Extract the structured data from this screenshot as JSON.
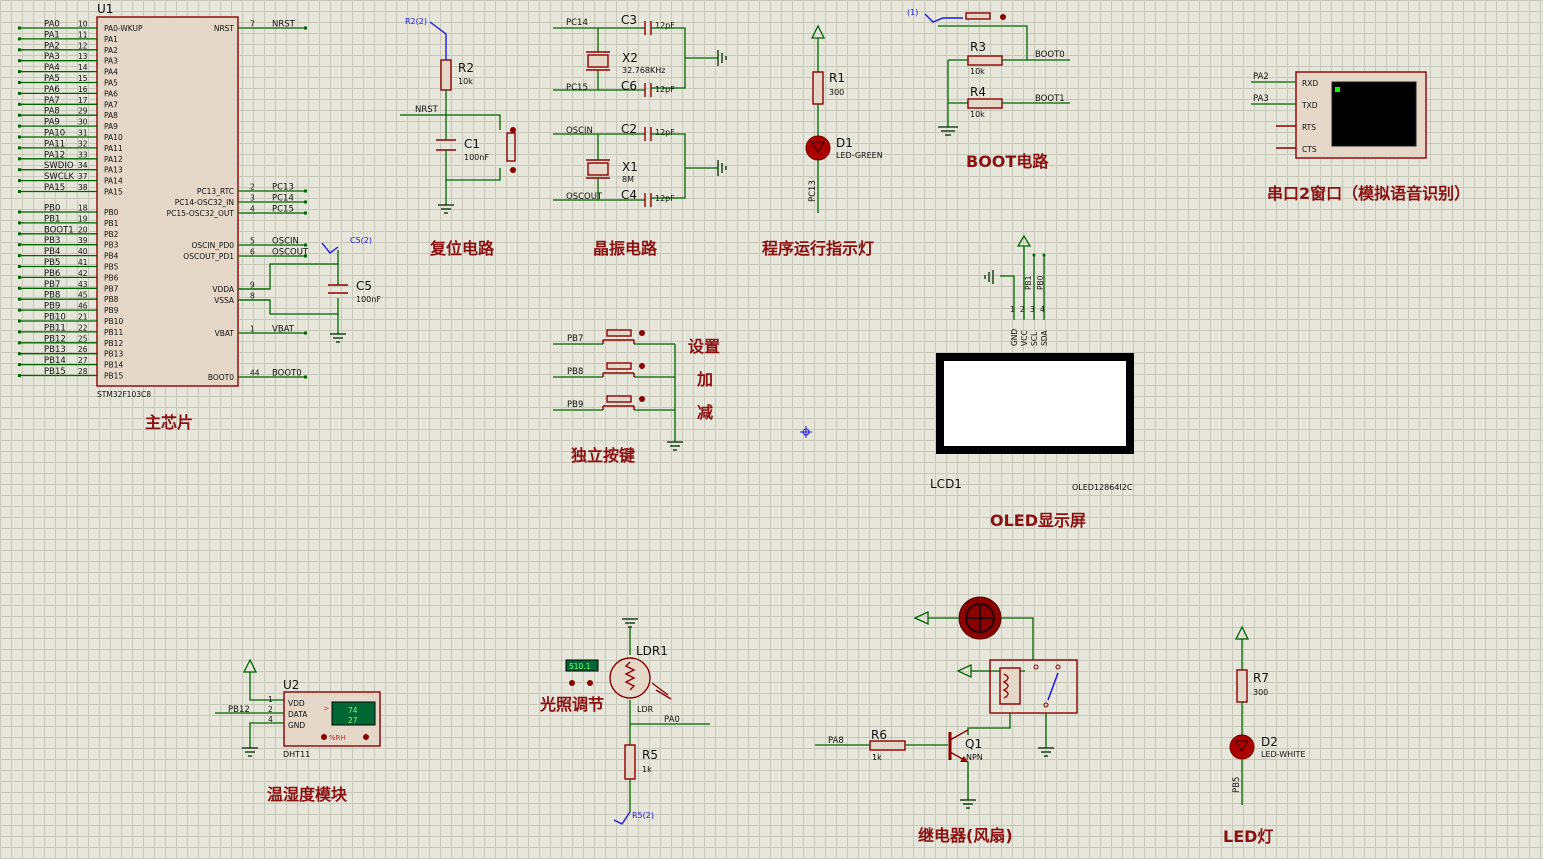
{
  "u1": {
    "ref": "U1",
    "part": "STM32F103C8",
    "left_pins": [
      {
        "net": "PA0",
        "num": "10",
        "name": "PA0-WKUP"
      },
      {
        "net": "PA1",
        "num": "11",
        "name": "PA1"
      },
      {
        "net": "PA2",
        "num": "12",
        "name": "PA2"
      },
      {
        "net": "PA3",
        "num": "13",
        "name": "PA3"
      },
      {
        "net": "PA4",
        "num": "14",
        "name": "PA4"
      },
      {
        "net": "PA5",
        "num": "15",
        "name": "PA5"
      },
      {
        "net": "PA6",
        "num": "16",
        "name": "PA6"
      },
      {
        "net": "PA7",
        "num": "17",
        "name": "PA7"
      },
      {
        "net": "PA8",
        "num": "29",
        "name": "PA8"
      },
      {
        "net": "PA9",
        "num": "30",
        "name": "PA9"
      },
      {
        "net": "PA10",
        "num": "31",
        "name": "PA10"
      },
      {
        "net": "PA11",
        "num": "32",
        "name": "PA11"
      },
      {
        "net": "PA12",
        "num": "33",
        "name": "PA12"
      },
      {
        "net": "SWDIO",
        "num": "34",
        "name": "PA13"
      },
      {
        "net": "SWCLK",
        "num": "37",
        "name": "PA14"
      },
      {
        "net": "PA15",
        "num": "38",
        "name": "PA15"
      },
      {
        "net": "PB0",
        "num": "18",
        "name": "PB0"
      },
      {
        "net": "PB1",
        "num": "19",
        "name": "PB1"
      },
      {
        "net": "BOOT1",
        "num": "20",
        "name": "PB2"
      },
      {
        "net": "PB3",
        "num": "39",
        "name": "PB3"
      },
      {
        "net": "PB4",
        "num": "40",
        "name": "PB4"
      },
      {
        "net": "PB5",
        "num": "41",
        "name": "PB5"
      },
      {
        "net": "PB6",
        "num": "42",
        "name": "PB6"
      },
      {
        "net": "PB7",
        "num": "43",
        "name": "PB7"
      },
      {
        "net": "PB8",
        "num": "45",
        "name": "PB8"
      },
      {
        "net": "PB9",
        "num": "46",
        "name": "PB9"
      },
      {
        "net": "PB10",
        "num": "21",
        "name": "PB10"
      },
      {
        "net": "PB11",
        "num": "22",
        "name": "PB11"
      },
      {
        "net": "PB12",
        "num": "25",
        "name": "PB12"
      },
      {
        "net": "PB13",
        "num": "26",
        "name": "PB13"
      },
      {
        "net": "PB14",
        "num": "27",
        "name": "PB14"
      },
      {
        "net": "PB15",
        "num": "28",
        "name": "PB15"
      }
    ],
    "right_pins": [
      {
        "name": "NRST",
        "num": "7",
        "net": "NRST"
      },
      {
        "name": "PC13_RTC",
        "num": "2",
        "net": "PC13"
      },
      {
        "name": "PC14-OSC32_IN",
        "num": "3",
        "net": "PC14"
      },
      {
        "name": "PC15-OSC32_OUT",
        "num": "4",
        "net": "PC15"
      },
      {
        "name": "OSCIN_PD0",
        "num": "5",
        "net": "OSCIN"
      },
      {
        "name": "OSCOUT_PD1",
        "num": "6",
        "net": "OSCOUT"
      },
      {
        "name": "VDDA",
        "num": "9",
        "net": ""
      },
      {
        "name": "VSSA",
        "num": "8",
        "net": ""
      },
      {
        "name": "VBAT",
        "num": "1",
        "net": "VBAT"
      },
      {
        "name": "BOOT0",
        "num": "44",
        "net": "BOOT0"
      }
    ]
  },
  "labels": {
    "main_chip": "主芯片",
    "reset": "复位电路",
    "crystal": "晶振电路",
    "run_led": "程序运行指示灯",
    "boot": "BOOT电路",
    "uart": "串口2窗口（模拟语音识别）",
    "keys": "独立按键",
    "key_set": "设置",
    "key_add": "加",
    "key_sub": "减",
    "oled": "OLED显示屏",
    "dht": "温湿度模块",
    "light": "光照调节",
    "relay": "继电器(风扇)",
    "led": "LED灯"
  },
  "reset_circuit": {
    "r_ref": "R2",
    "r_val": "10k",
    "c_ref": "C1",
    "c_val": "100nF",
    "net": "NRST",
    "probe": "R2(2)"
  },
  "crystal_circuit": {
    "c3": "C3",
    "c3_val": "12pF",
    "c6": "C6",
    "c6_val": "12pF",
    "x2": "X2",
    "x2_val": "32.768KHz",
    "c2": "C2",
    "c2_val": "12pF",
    "c4": "C4",
    "c4_val": "12pF",
    "x1": "X1",
    "x1_val": "8M",
    "pc14": "PC14",
    "pc15": "PC15",
    "oscin": "OSCIN",
    "oscout": "OSCOUT"
  },
  "c5": {
    "ref": "C5",
    "val": "100nF",
    "probe": "C5(2)",
    "vbat": "VBAT"
  },
  "run_led_circuit": {
    "r_ref": "R1",
    "r_val": "300",
    "d_ref": "D1",
    "d_val": "LED-GREEN",
    "net": "PC13"
  },
  "boot_circuit": {
    "probe": "(1)",
    "r3": "R3",
    "r3_val": "10k",
    "r4": "R4",
    "r4_val": "10k",
    "boot0": "BOOT0",
    "boot1": "BOOT1"
  },
  "uart_terminal": {
    "pa2": "PA2",
    "pa3": "PA3",
    "pins": [
      "RXD",
      "TXD",
      "RTS",
      "CTS"
    ]
  },
  "keys_circuit": {
    "nets": [
      "PB7",
      "PB8",
      "PB9"
    ]
  },
  "oled_module": {
    "ref": "LCD1",
    "part": "OLED12864I2C",
    "pins": [
      "GND",
      "VCC",
      "SCL",
      "SDA"
    ],
    "pin_nums": [
      "1",
      "2",
      "3",
      "4"
    ],
    "nets": [
      "PB1",
      "PB0"
    ]
  },
  "dht": {
    "ref": "U2",
    "part": "DHT11",
    "pins": [
      "VDD",
      "DATA",
      "GND"
    ],
    "pin_nums": [
      "1",
      "2",
      "4"
    ],
    "net": "PB12",
    "temp": "74",
    "hum": "27",
    "unit": "%RH"
  },
  "ldr": {
    "ref": "LDR1",
    "part": "LDR",
    "readout": "510.1",
    "r_ref": "R5",
    "r_val": "1k",
    "net": "PA0",
    "probe": "R5(2)"
  },
  "relay_circuit": {
    "r_ref": "R6",
    "r_val": "1k",
    "q_ref": "Q1",
    "q_val": "NPN",
    "net": "PA8"
  },
  "led_circuit": {
    "r_ref": "R7",
    "r_val": "300",
    "d_ref": "D2",
    "d_val": "LED-WHITE",
    "net": "PB5"
  },
  "colors": {
    "wire": "#006400",
    "component": "#8b0000",
    "section_title": "#8b1010",
    "grid": "#c8c8ba",
    "background": "#e6e6da"
  }
}
